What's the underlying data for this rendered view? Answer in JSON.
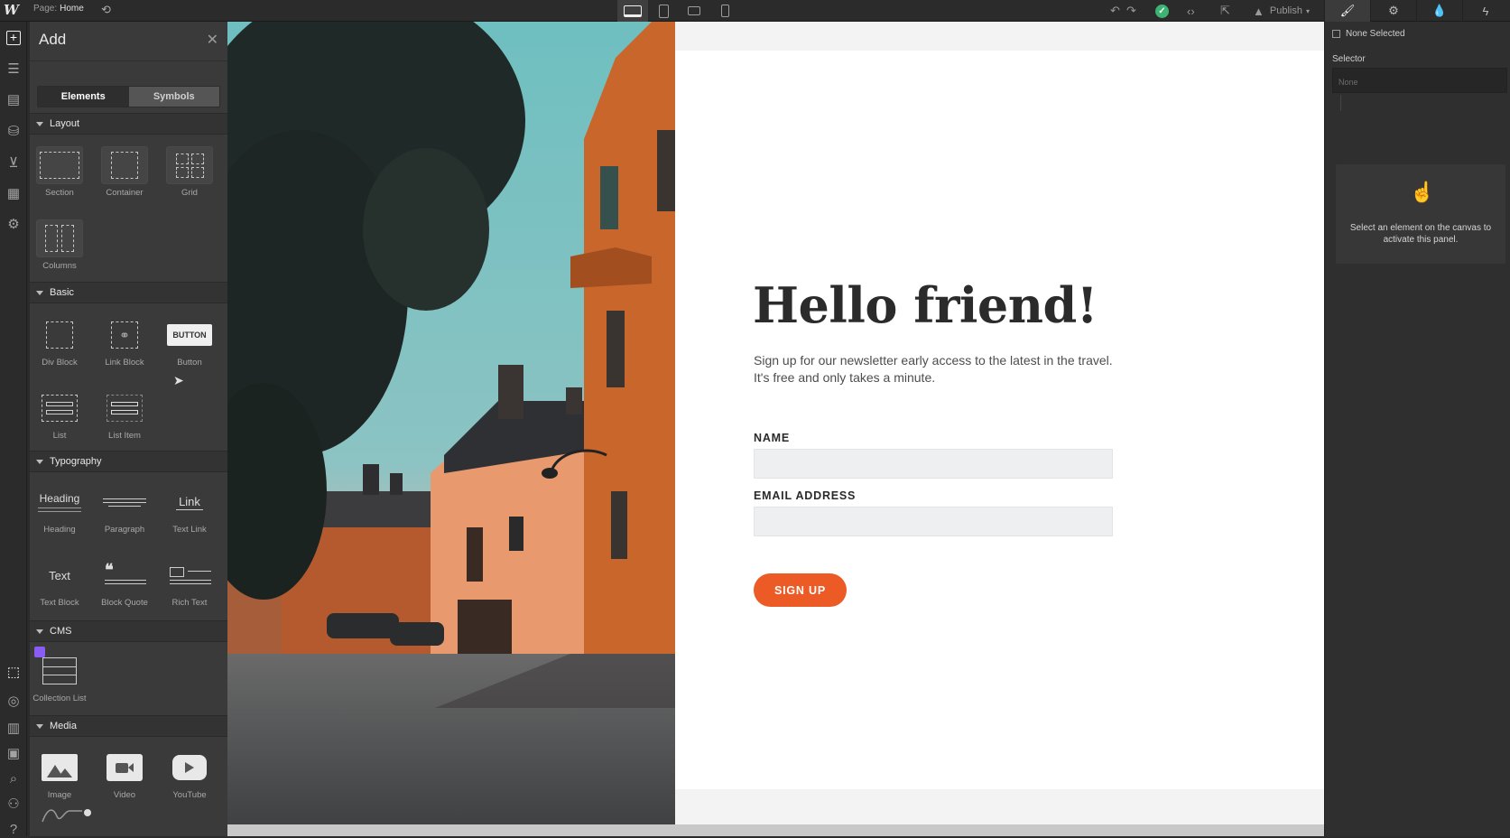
{
  "topbar": {
    "page_label": "Page:",
    "page_name": "Home",
    "publish_label": "Publish"
  },
  "add_panel": {
    "title": "Add",
    "tabs": [
      "Elements",
      "Symbols"
    ],
    "sections": {
      "layout": {
        "title": "Layout",
        "items": [
          "Section",
          "Container",
          "Grid",
          "Columns"
        ]
      },
      "basic": {
        "title": "Basic",
        "items": [
          "Div Block",
          "Link Block",
          "Button",
          "List",
          "List Item"
        ],
        "button_thumb_text": "BUTTON"
      },
      "typography": {
        "title": "Typography",
        "items": [
          "Heading",
          "Paragraph",
          "Text Link",
          "Text Block",
          "Block Quote",
          "Rich Text"
        ],
        "heading_thumb": "Heading",
        "link_thumb": "Link",
        "text_thumb": "Text"
      },
      "cms": {
        "title": "CMS",
        "items": [
          "Collection List"
        ]
      },
      "media": {
        "title": "Media",
        "items": [
          "Image",
          "Video",
          "YouTube"
        ]
      }
    }
  },
  "canvas": {
    "heading": "Hello friend!",
    "subtitle": "Sign up for our newsletter early access to the latest in the travel. It's free and only takes a minute.",
    "name_label": "NAME",
    "email_label": "EMAIL ADDRESS",
    "button_label": "SIGN UP",
    "accent_color": "#ec5a25"
  },
  "right_panel": {
    "none_selected": "None Selected",
    "selector_label": "Selector",
    "selector_placeholder": "None",
    "empty_message": "Select an element on the canvas to activate this panel."
  }
}
